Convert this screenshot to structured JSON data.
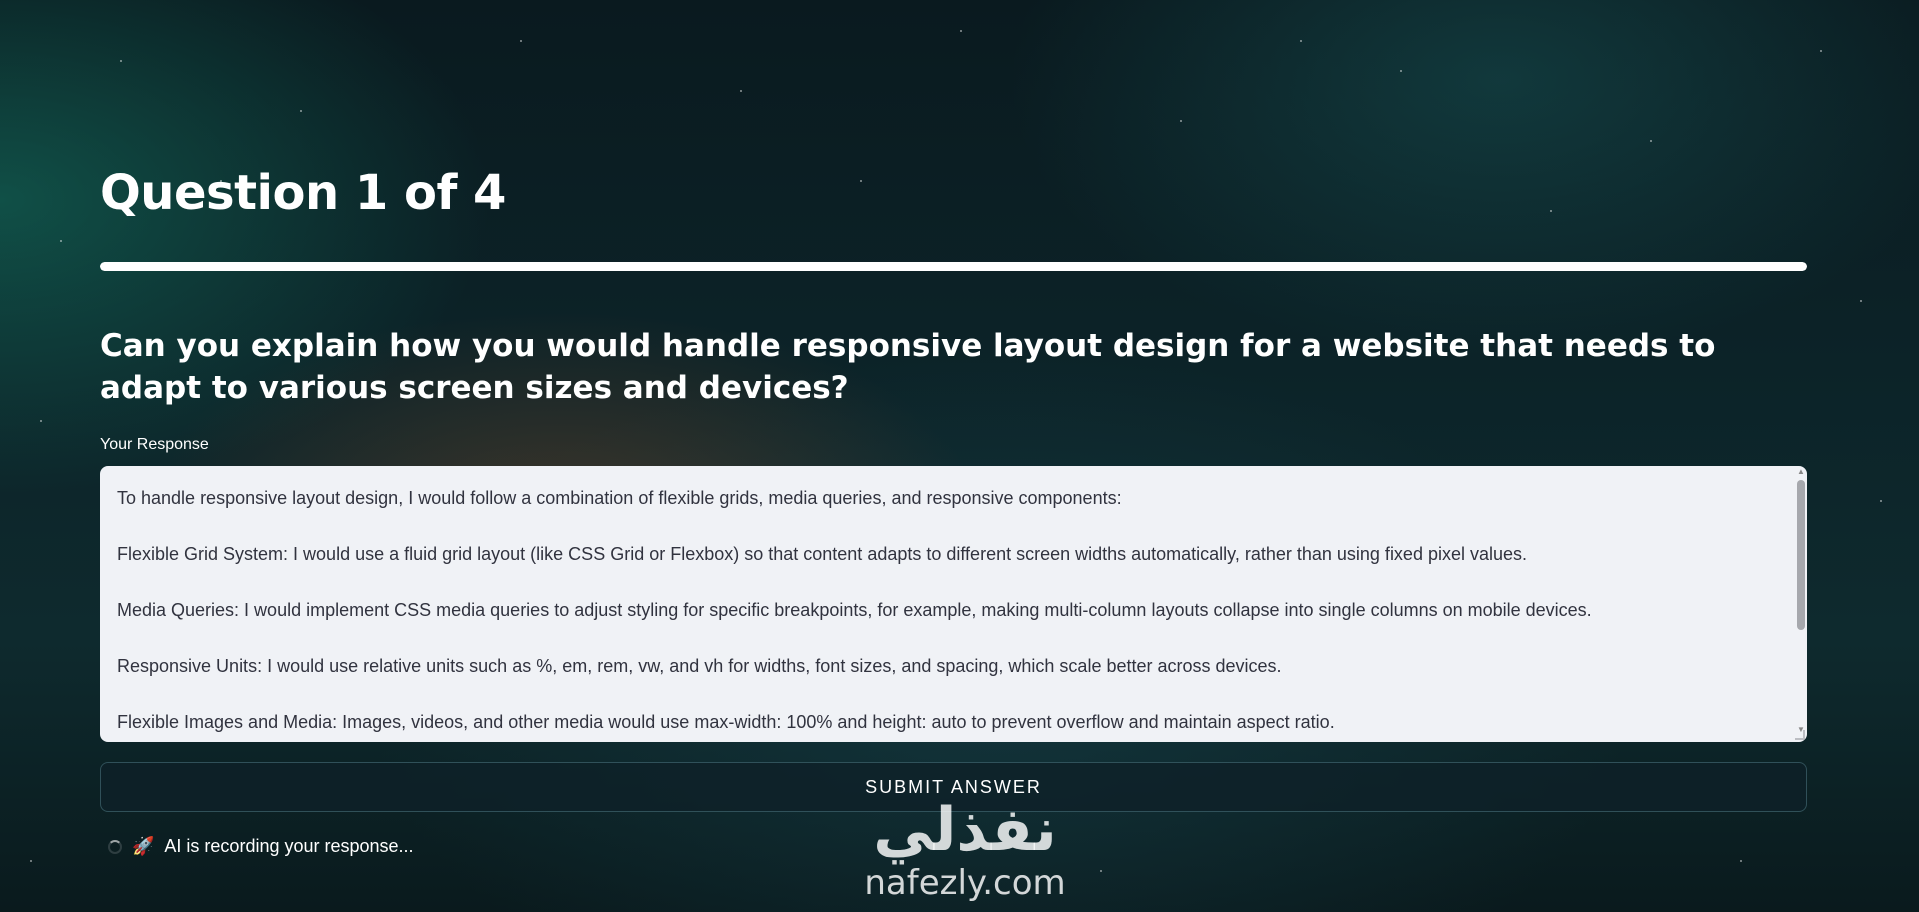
{
  "page": {
    "title": "Question 1 of 4",
    "progress_fraction": 1.0
  },
  "question": {
    "text": "Can you explain how you would handle responsive layout design for a website that needs to adapt to various screen sizes and devices?"
  },
  "response": {
    "label": "Your Response",
    "paragraphs": [
      "To handle responsive layout design, I would follow a combination of flexible grids, media queries, and responsive components:",
      "Flexible Grid System: I would use a fluid grid layout (like CSS Grid or Flexbox) so that content adapts to different screen widths automatically, rather than using fixed pixel values.",
      "Media Queries: I would implement CSS media queries to adjust styling for specific breakpoints, for example, making multi-column layouts collapse into single columns on mobile devices.",
      "Responsive Units: I would use relative units such as %, em, rem, vw, and vh for widths, font sizes, and spacing, which scale better across devices.",
      "Flexible Images and Media: Images, videos, and other media would use max-width: 100% and height: auto to prevent overflow and maintain aspect ratio."
    ]
  },
  "submit": {
    "label": "SUBMIT ANSWER"
  },
  "status": {
    "icon": "rocket-icon",
    "emoji": "🚀",
    "text": "AI is recording your response..."
  },
  "watermark": {
    "arabic": "نفذلي",
    "latin": "nafezly.com"
  }
}
